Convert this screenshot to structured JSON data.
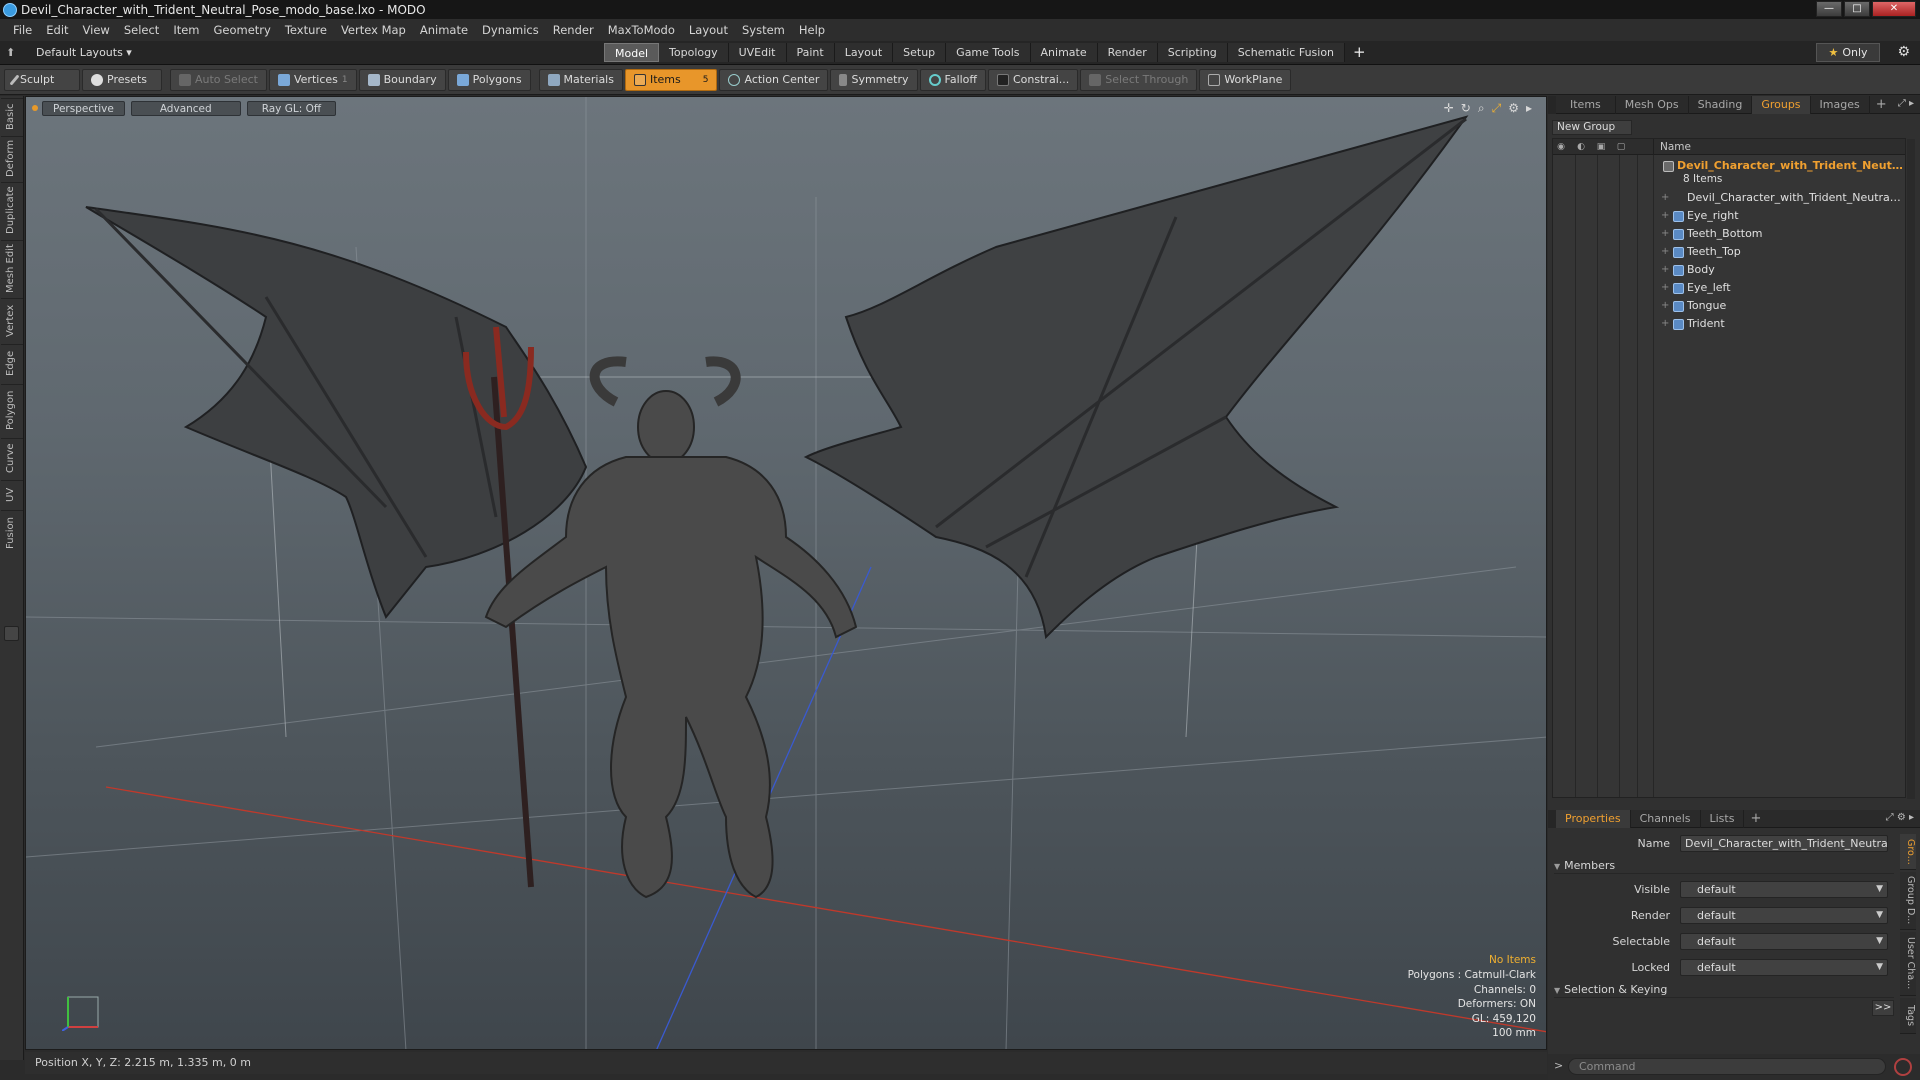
{
  "window": {
    "title": "Devil_Character_with_Trident_Neutral_Pose_modo_base.lxo - MODO",
    "controls": [
      "—",
      "□",
      "✕"
    ]
  },
  "menu": [
    "File",
    "Edit",
    "View",
    "Select",
    "Item",
    "Geometry",
    "Texture",
    "Vertex Map",
    "Animate",
    "Dynamics",
    "Render",
    "MaxToModo",
    "Layout",
    "System",
    "Help"
  ],
  "layouts": {
    "dropdown": "Default Layouts ▾",
    "tabs": [
      "Model",
      "Topology",
      "UVEdit",
      "Paint",
      "Layout",
      "Setup",
      "Game Tools",
      "Animate",
      "Render",
      "Scripting",
      "Schematic Fusion"
    ],
    "active_tab": "Model",
    "add": "+",
    "only_label": "Only",
    "only_star": "★"
  },
  "toolbar": {
    "sculpt": "Sculpt",
    "presets": "Presets",
    "auto_select": "Auto Select",
    "vertices": "Vertices",
    "vertices_count": "1",
    "boundary": "Boundary",
    "polygons": "Polygons",
    "materials": "Materials",
    "items": "Items",
    "items_count": "5",
    "action_center": "Action Center",
    "symmetry": "Symmetry",
    "falloff": "Falloff",
    "constraints": "Constrai...",
    "select_through": "Select Through",
    "workplane": "WorkPlane"
  },
  "left_tabs": [
    "Basic",
    "Deform",
    "Duplicate",
    "Mesh Edit",
    "Vertex",
    "Edge",
    "Polygon",
    "Curve",
    "UV",
    "Fusion"
  ],
  "viewport": {
    "headers": [
      "Perspective",
      "Advanced",
      "Ray GL: Off"
    ],
    "info": {
      "no_items": "No Items",
      "polygons": "Polygons : Catmull-Clark",
      "channels": "Channels: 0",
      "deformers": "Deformers: ON",
      "gl": "GL: 459,120",
      "scale": "100 mm"
    },
    "colors": {
      "x_axis": "#c0392b",
      "z_axis": "#3a5ad0",
      "grid": "#8a9299"
    }
  },
  "statusbar": {
    "position": "Position X, Y, Z:  2.215 m, 1.335 m, 0 m"
  },
  "groups_panel": {
    "tabs": [
      "Items",
      "Mesh Ops",
      "Shading",
      "Groups",
      "Images"
    ],
    "active_tab": "Groups",
    "new_group": "New Group",
    "name_col": "Name",
    "group_name": "Devil_Character_with_Trident_Neutr ...",
    "group_count": "8 Items",
    "items": [
      "Devil_Character_with_Trident_Neutral_P ...",
      "Eye_right",
      "Teeth_Bottom",
      "Teeth_Top",
      "Body",
      "Eye_left",
      "Tongue",
      "Trident"
    ]
  },
  "properties_panel": {
    "tabs": [
      "Properties",
      "Channels",
      "Lists"
    ],
    "active_tab": "Properties",
    "name_label": "Name",
    "name_value": "Devil_Character_with_Trident_Neutral_Pc",
    "members_label": "Members",
    "fields": [
      {
        "label": "Visible",
        "value": "default"
      },
      {
        "label": "Render",
        "value": "default"
      },
      {
        "label": "Selectable",
        "value": "default"
      },
      {
        "label": "Locked",
        "value": "default"
      }
    ],
    "selection_keying": "Selection & Keying",
    "more": ">>",
    "side_tabs": [
      "Gro...",
      "Group D...",
      "User Cha...",
      "Tags"
    ]
  },
  "command": {
    "placeholder": "Command",
    "prompt": ">"
  }
}
